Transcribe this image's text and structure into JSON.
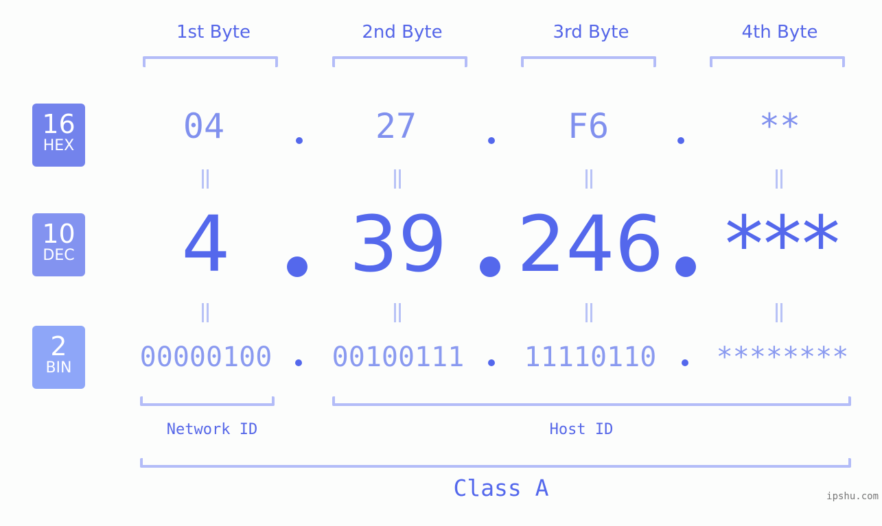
{
  "bytes": [
    {
      "label": "1st Byte",
      "hex": "04",
      "dec": "4",
      "bin": "00000100"
    },
    {
      "label": "2nd Byte",
      "hex": "27",
      "dec": "39",
      "bin": "00100111"
    },
    {
      "label": "3rd Byte",
      "hex": "F6",
      "dec": "246",
      "bin": "11110110"
    },
    {
      "label": "4th Byte",
      "hex": "**",
      "dec": "***",
      "bin": "********"
    }
  ],
  "bases": {
    "hex": {
      "number": "16",
      "label": "HEX",
      "color": "#7383ec"
    },
    "dec": {
      "number": "10",
      "label": "DEC",
      "color": "#8393f0"
    },
    "bin": {
      "number": "2",
      "label": "BIN",
      "color": "#8ea6f8"
    }
  },
  "segments": {
    "network": "Network ID",
    "host": "Host ID"
  },
  "class_label": "Class A",
  "watermark": "ipshu.com",
  "colors": {
    "accent": "#5468ec",
    "bracket": "#b3bcf8",
    "hex_text": "#8090ee",
    "bin_text": "#8a9af0"
  }
}
